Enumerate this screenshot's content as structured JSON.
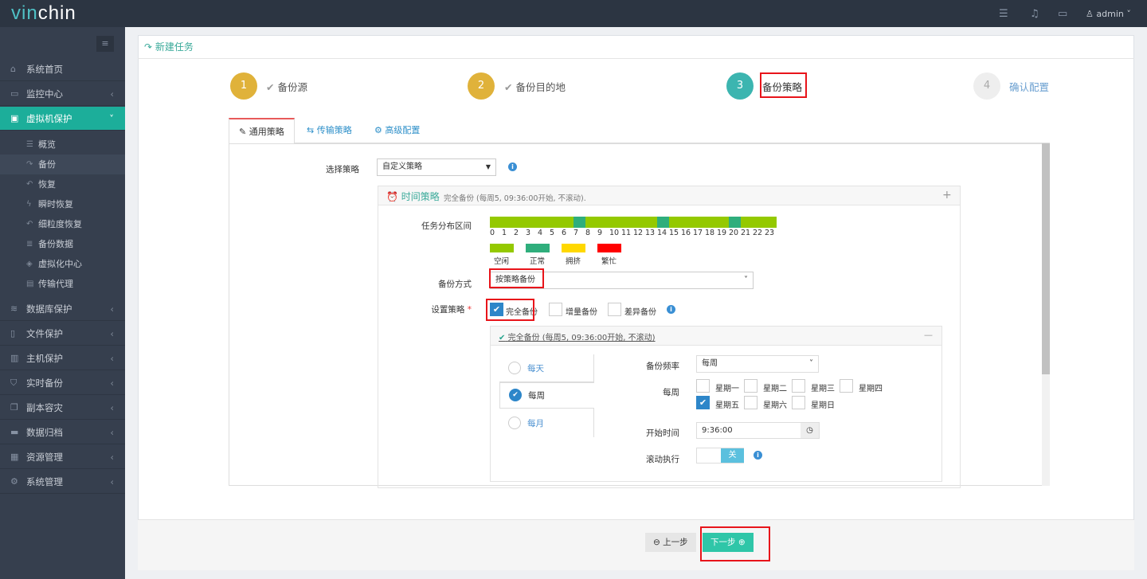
{
  "brand": {
    "part1": "vin",
    "part2": "chin"
  },
  "topbar": {
    "user": "admin",
    "icons": [
      "server-icon",
      "bell-icon",
      "monitor-icon",
      "user-icon"
    ]
  },
  "sidebar": {
    "items": [
      {
        "label": "系统首页",
        "icon": "home-icon"
      },
      {
        "label": "监控中心",
        "icon": "laptop-icon"
      },
      {
        "label": "虚拟机保护",
        "icon": "desktop-icon"
      }
    ],
    "sub": [
      {
        "label": "概览"
      },
      {
        "label": "备份"
      },
      {
        "label": "恢复"
      },
      {
        "label": "瞬时恢复"
      },
      {
        "label": "细粒度恢复"
      },
      {
        "label": "备份数据"
      },
      {
        "label": "虚拟化中心"
      },
      {
        "label": "传输代理"
      }
    ],
    "items2": [
      {
        "label": "数据库保护"
      },
      {
        "label": "文件保护"
      },
      {
        "label": "主机保护"
      },
      {
        "label": "实时备份"
      },
      {
        "label": "副本容灾"
      },
      {
        "label": "数据归档"
      },
      {
        "label": "资源管理"
      },
      {
        "label": "系统管理"
      }
    ]
  },
  "page": {
    "title": "新建任务"
  },
  "steps": [
    {
      "num": "1",
      "label": "备份源"
    },
    {
      "num": "2",
      "label": "备份目的地"
    },
    {
      "num": "3",
      "label": "备份策略"
    },
    {
      "num": "4",
      "label": "确认配置"
    }
  ],
  "tabs": [
    "通用策略",
    "传输策略",
    "高级配置"
  ],
  "form": {
    "strategy_label": "选择策略",
    "strategy_value": "自定义策略",
    "time_title": "时间策略",
    "time_summary": "完全备份 (每周5, 09:36:00开始, 不滚动).",
    "dist_label": "任务分布区间",
    "method_label": "备份方式",
    "method_value": "按策略备份",
    "policy_label": "设置策略",
    "required": "*",
    "policies": [
      {
        "label": "完全备份",
        "checked": true
      },
      {
        "label": "增量备份",
        "checked": false
      },
      {
        "label": "差异备份",
        "checked": false
      }
    ]
  },
  "chart_data": {
    "type": "timeline",
    "hours": [
      "0",
      "1",
      "2",
      "3",
      "4",
      "5",
      "6",
      "7",
      "8",
      "9",
      "10",
      "11",
      "12",
      "13",
      "14",
      "15",
      "16",
      "17",
      "18",
      "19",
      "20",
      "21",
      "22",
      "23"
    ],
    "status": [
      "idle",
      "idle",
      "idle",
      "idle",
      "idle",
      "idle",
      "idle",
      "normal",
      "idle",
      "idle",
      "idle",
      "idle",
      "idle",
      "idle",
      "normal",
      "idle",
      "idle",
      "idle",
      "idle",
      "idle",
      "normal",
      "idle",
      "idle",
      "idle"
    ],
    "legend": [
      {
        "key": "idle",
        "label": "空闲",
        "color": "#94c900"
      },
      {
        "key": "normal",
        "label": "正常",
        "color": "#2fae7c"
      },
      {
        "key": "busy",
        "label": "拥挤",
        "color": "#ffd800"
      },
      {
        "key": "full",
        "label": "繁忙",
        "color": "#ff0000"
      }
    ]
  },
  "full": {
    "header": "完全备份 (每周5, 09:36:00开始, 不滚动)",
    "freq_options": [
      {
        "label": "每天",
        "on": false
      },
      {
        "label": "每周",
        "on": true
      },
      {
        "label": "每月",
        "on": false
      }
    ],
    "freq_label": "备份频率",
    "freq_value": "每周",
    "week_label": "每周",
    "days": [
      {
        "label": "星期一",
        "on": false
      },
      {
        "label": "星期二",
        "on": false
      },
      {
        "label": "星期三",
        "on": false
      },
      {
        "label": "星期四",
        "on": false
      },
      {
        "label": "星期五",
        "on": true
      },
      {
        "label": "星期六",
        "on": false
      },
      {
        "label": "星期日",
        "on": false
      }
    ],
    "start_label": "开始时间",
    "start_value": "9:36:00",
    "roll_label": "滚动执行",
    "roll_value": "关"
  },
  "buttons": {
    "prev": "上一步",
    "next": "下一步"
  }
}
